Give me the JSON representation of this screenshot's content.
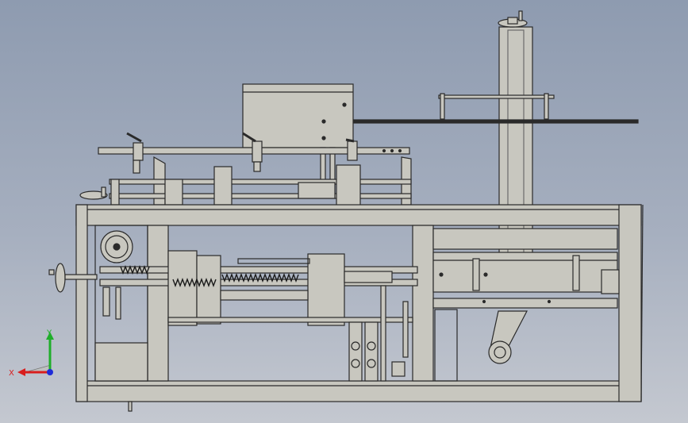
{
  "viewport": {
    "view": "front",
    "background_colors": [
      "#8e9bb0",
      "#c4c8d0"
    ],
    "model_color": "#c8c7bf",
    "edge_color": "#2a2a2a"
  },
  "triad": {
    "x_label": "X",
    "y_label": "Y",
    "x_color": "#d81e1e",
    "y_color": "#1fae2a",
    "z_color": "#1e2bd8"
  }
}
